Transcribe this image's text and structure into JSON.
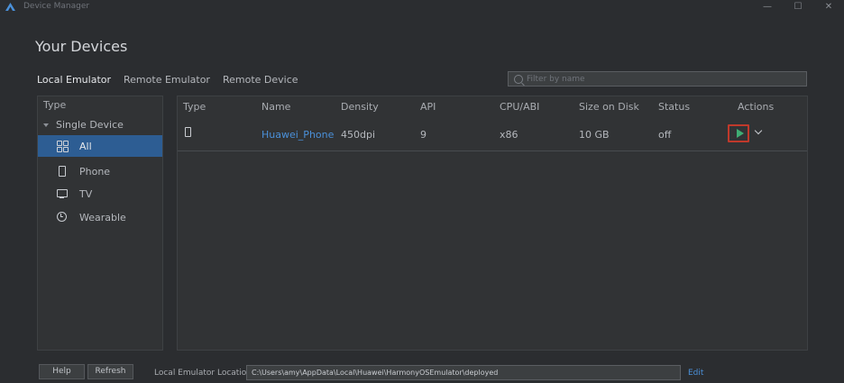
{
  "window": {
    "title": "Device Manager",
    "minimize": "—",
    "maximize": "☐",
    "close": "✕"
  },
  "heading": "Your Devices",
  "tabs": [
    {
      "label": "Local Emulator",
      "active": true
    },
    {
      "label": "Remote Emulator",
      "active": false
    },
    {
      "label": "Remote Device",
      "active": false
    }
  ],
  "search": {
    "placeholder": "Filter by name"
  },
  "sidebar": {
    "header": "Type",
    "group": "Single Device",
    "items": [
      {
        "label": "All",
        "icon": "grid-icon",
        "selected": true
      },
      {
        "label": "Phone",
        "icon": "phone-icon",
        "selected": false
      },
      {
        "label": "TV",
        "icon": "tv-icon",
        "selected": false
      },
      {
        "label": "Wearable",
        "icon": "watch-icon",
        "selected": false
      }
    ]
  },
  "table": {
    "columns": [
      "Type",
      "Name",
      "Density",
      "API",
      "CPU/ABI",
      "Size on Disk",
      "Status",
      "Actions"
    ],
    "rows": [
      {
        "type_icon": "phone-icon",
        "name": "Huawei_Phone",
        "density": "450dpi",
        "api": "9",
        "cpu": "x86",
        "size": "10 GB",
        "status": "off"
      }
    ]
  },
  "footer": {
    "help": "Help",
    "refresh": "Refresh",
    "location_label": "Local Emulator Location:",
    "location_value": "C:\\Users\\amy\\AppData\\Local\\Huawei\\HarmonyOSEmulator\\deployed",
    "edit": "Edit"
  },
  "colors": {
    "accent": "#2d5d93",
    "link": "#4a90d9",
    "play": "#3fae74",
    "highlight": "#c0392b"
  }
}
